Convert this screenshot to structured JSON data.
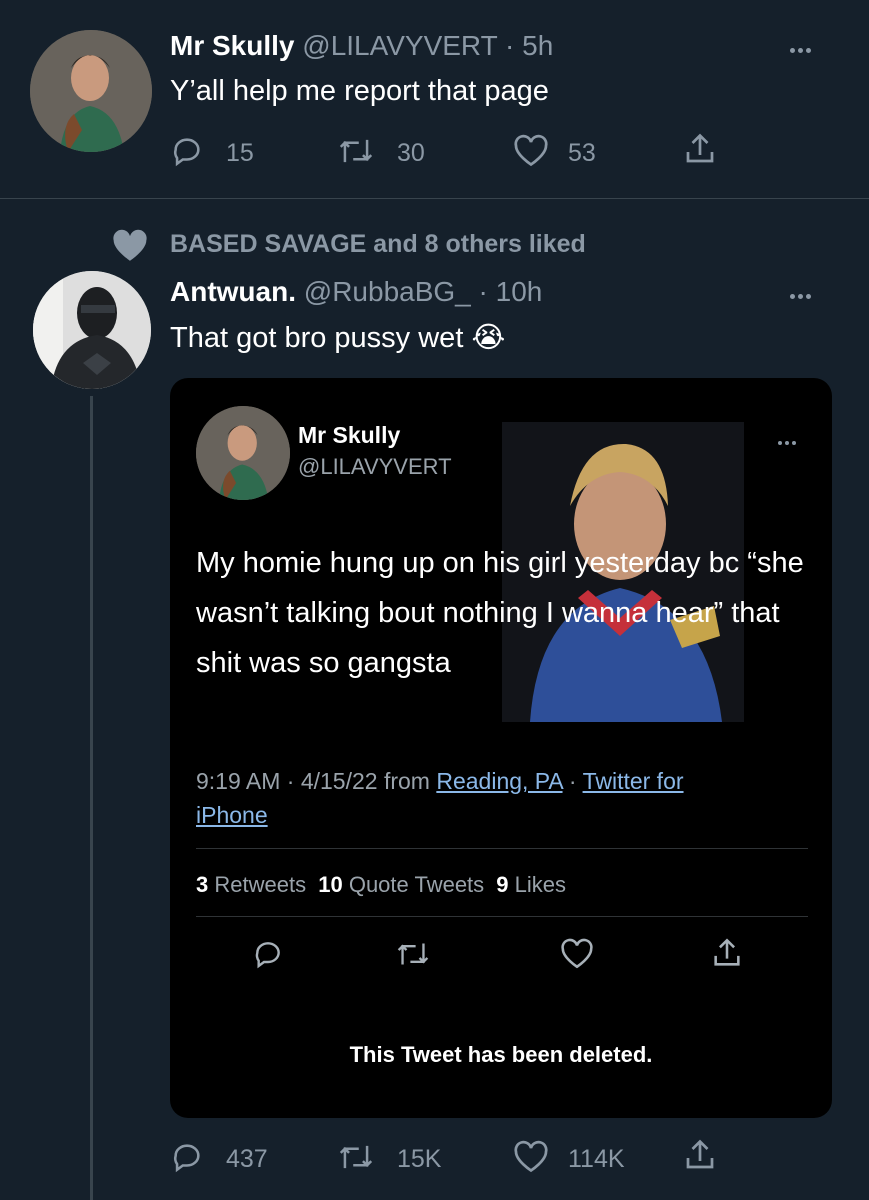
{
  "tweet1": {
    "display_name": "Mr Skully",
    "handle": "@LILAVYVERT",
    "time": "· 5h",
    "text": "Y’all help me report that page",
    "replies": "15",
    "retweets": "30",
    "likes": "53",
    "icons": [
      "reply-icon",
      "retweet-icon",
      "like-icon",
      "share-icon",
      "more-icon"
    ]
  },
  "social_context": {
    "text": "BASED SAVAGE and 8 others liked",
    "icon": "heart-icon"
  },
  "tweet2": {
    "display_name": "Antwuan.",
    "handle": "@RubbaBG_",
    "time": "· 10h",
    "text": "That got bro pussy wet",
    "emoji": "😭",
    "replies": "437",
    "retweets": "15K",
    "likes": "114K"
  },
  "embedded": {
    "display_name": "Mr Skully",
    "handle": "@LILAVYVERT",
    "text": "My homie hung up on his girl yesterday bc “she wasn’t talking bout nothing I wanna hear” that shit was so gangsta",
    "time_date": "9:19 AM · 4/15/22 from",
    "location": "Reading, PA",
    "separator": "·",
    "client_part1": "Twitter for",
    "client_part2": "iPhone",
    "stats": {
      "retweets_count": "3",
      "retweets_label": "Retweets",
      "quotes_count": "10",
      "quotes_label": "Quote Tweets",
      "likes_count": "9",
      "likes_label": "Likes"
    },
    "deleted_notice": "This Tweet has been deleted."
  },
  "colors": {
    "background": "#15202b",
    "embedded_card": "#000000",
    "divider": "#38444d",
    "muted_text": "#8b98a5",
    "link": "#8bb8e8"
  }
}
